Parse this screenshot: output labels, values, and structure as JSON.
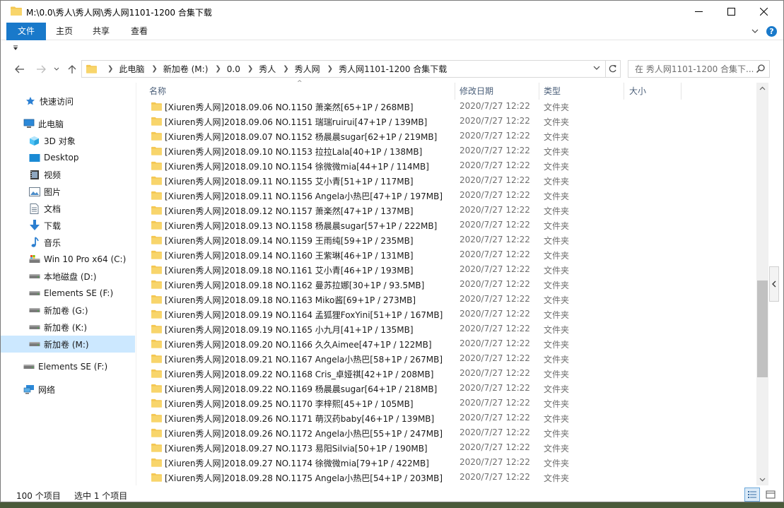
{
  "window": {
    "title": "M:\\0.0\\秀人\\秀人网\\秀人网1101-1200 合集下载"
  },
  "ribbon": {
    "tabs": [
      "文件",
      "主页",
      "共享",
      "查看"
    ],
    "help": "?"
  },
  "address": {
    "crumbs": [
      "此电脑",
      "新加卷 (M:)",
      "0.0",
      "秀人",
      "秀人网",
      "秀人网1101-1200 合集下载"
    ]
  },
  "search": {
    "placeholder": "在 秀人网1101-1200 合集下..."
  },
  "sidebar": {
    "items": [
      {
        "label": "快速访问",
        "icon": "star-icon"
      },
      {
        "label": "此电脑",
        "icon": "computer-icon"
      },
      {
        "label": "3D 对象",
        "icon": "cube-3d-icon"
      },
      {
        "label": "Desktop",
        "icon": "desktop-icon"
      },
      {
        "label": "视频",
        "icon": "video-icon"
      },
      {
        "label": "图片",
        "icon": "picture-icon"
      },
      {
        "label": "文档",
        "icon": "document-icon"
      },
      {
        "label": "下载",
        "icon": "download-icon"
      },
      {
        "label": "音乐",
        "icon": "music-icon"
      },
      {
        "label": "Win 10 Pro x64 (C:)",
        "icon": "system-drive-icon"
      },
      {
        "label": "本地磁盘 (D:)",
        "icon": "drive-icon"
      },
      {
        "label": "Elements SE (F:)",
        "icon": "drive-icon"
      },
      {
        "label": "新加卷 (G:)",
        "icon": "drive-icon"
      },
      {
        "label": "新加卷 (K:)",
        "icon": "drive-icon"
      },
      {
        "label": "新加卷 (M:)",
        "icon": "drive-icon"
      },
      {
        "label": "Elements SE (F:)",
        "icon": "drive-icon"
      },
      {
        "label": "网络",
        "icon": "network-icon"
      }
    ]
  },
  "columns": {
    "name": "名称",
    "date": "修改日期",
    "type": "类型",
    "size": "大小"
  },
  "files": [
    {
      "name": "[Xiuren秀人网]2018.09.06 NO.1150 萧楽然[65+1P / 268MB]",
      "date": "2020/7/27 12:22",
      "type": "文件夹"
    },
    {
      "name": "[Xiuren秀人网]2018.09.06 NO.1151 瑞瑞ruirui[47+1P / 139MB]",
      "date": "2020/7/27 12:22",
      "type": "文件夹"
    },
    {
      "name": "[Xiuren秀人网]2018.09.07 NO.1152 杨晨晨sugar[62+1P / 219MB]",
      "date": "2020/7/27 12:22",
      "type": "文件夹"
    },
    {
      "name": "[Xiuren秀人网]2018.09.10 NO.1153 拉拉Lala[40+1P / 138MB]",
      "date": "2020/7/27 12:22",
      "type": "文件夹"
    },
    {
      "name": "[Xiuren秀人网]2018.09.10 NO.1154 徐微微mia[44+1P / 114MB]",
      "date": "2020/7/27 12:22",
      "type": "文件夹"
    },
    {
      "name": "[Xiuren秀人网]2018.09.11 NO.1155 艾小青[51+1P / 117MB]",
      "date": "2020/7/27 12:22",
      "type": "文件夹"
    },
    {
      "name": "[Xiuren秀人网]2018.09.11 NO.1156 Angela小热巴[47+1P / 197MB]",
      "date": "2020/7/27 12:22",
      "type": "文件夹"
    },
    {
      "name": "[Xiuren秀人网]2018.09.12 NO.1157 萧楽然[47+1P / 137MB]",
      "date": "2020/7/27 12:22",
      "type": "文件夹"
    },
    {
      "name": "[Xiuren秀人网]2018.09.13 NO.1158 杨晨晨sugar[57+1P / 222MB]",
      "date": "2020/7/27 12:22",
      "type": "文件夹"
    },
    {
      "name": "[Xiuren秀人网]2018.09.14 NO.1159 王雨纯[59+1P / 235MB]",
      "date": "2020/7/27 12:22",
      "type": "文件夹"
    },
    {
      "name": "[Xiuren秀人网]2018.09.14 NO.1160 王紫琳[46+1P / 131MB]",
      "date": "2020/7/27 12:22",
      "type": "文件夹"
    },
    {
      "name": "[Xiuren秀人网]2018.09.18 NO.1161 艾小青[46+1P / 193MB]",
      "date": "2020/7/27 12:22",
      "type": "文件夹"
    },
    {
      "name": "[Xiuren秀人网]2018.09.18 NO.1162 曼苏拉娜[30+1P / 93.5MB]",
      "date": "2020/7/27 12:22",
      "type": "文件夹"
    },
    {
      "name": "[Xiuren秀人网]2018.09.18 NO.1163 Miko酱[69+1P / 273MB]",
      "date": "2020/7/27 12:22",
      "type": "文件夹"
    },
    {
      "name": "[Xiuren秀人网]2018.09.19 NO.1164 孟狐狸FoxYini[51+1P / 167MB]",
      "date": "2020/7/27 12:22",
      "type": "文件夹"
    },
    {
      "name": "[Xiuren秀人网]2018.09.19 NO.1165 小九月[41+1P / 135MB]",
      "date": "2020/7/27 12:22",
      "type": "文件夹"
    },
    {
      "name": "[Xiuren秀人网]2018.09.20 NO.1166 久久Aimee[47+1P / 122MB]",
      "date": "2020/7/27 12:22",
      "type": "文件夹"
    },
    {
      "name": "[Xiuren秀人网]2018.09.21 NO.1167 Angela小热巴[58+1P / 267MB]",
      "date": "2020/7/27 12:22",
      "type": "文件夹"
    },
    {
      "name": "[Xiuren秀人网]2018.09.22 NO.1168 Cris_卓娅祺[42+1P / 208MB]",
      "date": "2020/7/27 12:22",
      "type": "文件夹"
    },
    {
      "name": "[Xiuren秀人网]2018.09.22 NO.1169 杨晨晨sugar[64+1P / 218MB]",
      "date": "2020/7/27 12:22",
      "type": "文件夹"
    },
    {
      "name": "[Xiuren秀人网]2018.09.25 NO.1170 李梓熙[45+1P / 105MB]",
      "date": "2020/7/27 12:22",
      "type": "文件夹"
    },
    {
      "name": "[Xiuren秀人网]2018.09.26 NO.1171 萌汉药baby[46+1P / 139MB]",
      "date": "2020/7/27 12:22",
      "type": "文件夹"
    },
    {
      "name": "[Xiuren秀人网]2018.09.26 NO.1172 Angela小热巴[55+1P / 247MB]",
      "date": "2020/7/27 12:22",
      "type": "文件夹"
    },
    {
      "name": "[Xiuren秀人网]2018.09.27 NO.1173 易阳Silvia[50+1P / 190MB]",
      "date": "2020/7/27 12:22",
      "type": "文件夹"
    },
    {
      "name": "[Xiuren秀人网]2018.09.27 NO.1174 徐微微mia[79+1P / 422MB]",
      "date": "2020/7/27 12:22",
      "type": "文件夹"
    },
    {
      "name": "[Xiuren秀人网]2018.09.28 NO.1175 Angela小热巴[54+1P / 203MB]",
      "date": "2020/7/27 12:22",
      "type": "文件夹"
    }
  ],
  "status": {
    "count": "100 个项目",
    "selected": "选中 1 个项目"
  },
  "colors": {
    "accent": "#1979ca",
    "selection": "#cce8ff",
    "folder": "#f4c752",
    "header_text": "#4c607a"
  }
}
